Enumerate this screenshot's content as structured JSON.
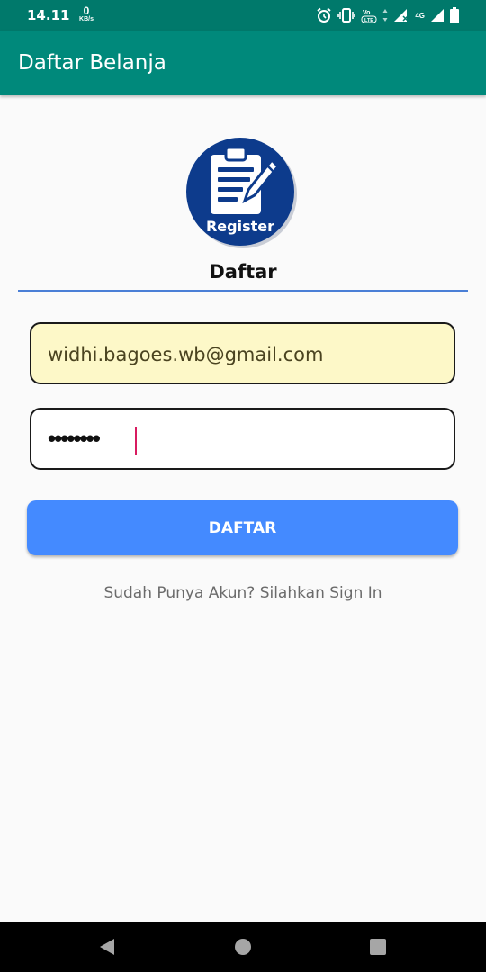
{
  "status_bar": {
    "time": "14.11",
    "speed_value": "0",
    "speed_unit": "KB/s",
    "volte_label": "VoLTE",
    "network_label": "4G",
    "icons": [
      "alarm-icon",
      "vibrate-icon",
      "volte-icon",
      "data-arrows-icon",
      "signal-icon",
      "battery-icon"
    ]
  },
  "app_bar": {
    "title": "Daftar Belanja"
  },
  "logo": {
    "text": "Register",
    "icon": "clipboard-pencil-icon"
  },
  "form": {
    "heading": "Daftar",
    "email_value": "widhi.bagoes.wb@gmail.com",
    "password_value": "••••••••",
    "submit_label": "DAFTAR",
    "signin_link": "Sudah Punya Akun? Silahkan Sign In"
  },
  "nav_bar": {
    "icons": [
      "back-icon",
      "home-icon",
      "recents-icon"
    ]
  },
  "colors": {
    "status_bar": "#00796b",
    "app_bar": "#00897b",
    "logo_circle": "#0d3b8c",
    "divider": "#4a7fd6",
    "email_field_bg": "#fdf8c8",
    "button": "#448aff",
    "caret": "#d81b60"
  }
}
